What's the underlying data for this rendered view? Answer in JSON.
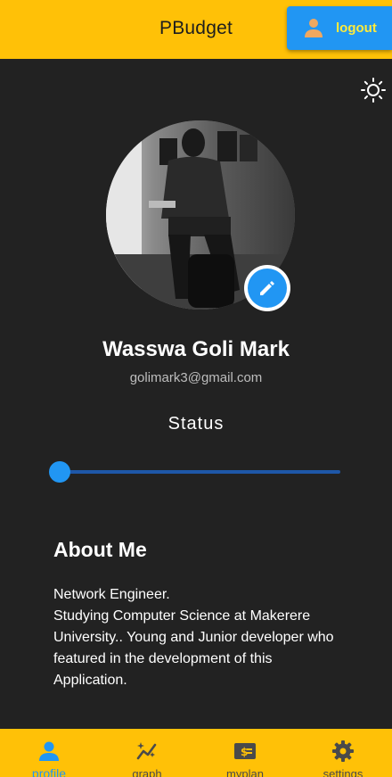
{
  "app_bar": {
    "title": "PBudget",
    "logout_label": "logout",
    "logout_icon": "person-icon"
  },
  "theme_toggle": {
    "icon": "sun-icon"
  },
  "profile": {
    "name": "Wasswa Goli Mark",
    "email": "golimark3@gmail.com",
    "edit_icon": "pencil-icon"
  },
  "status": {
    "label": "Status",
    "value": 0
  },
  "about": {
    "title": "About Me",
    "text": "Network Engineer.\nStudying Computer Science at Makerere University.. Young and Junior developer who featured in the development of this Application."
  },
  "bottom_nav": {
    "items": [
      {
        "label": "profile",
        "icon": "person-icon",
        "active": true
      },
      {
        "label": "graph",
        "icon": "auto-graph-icon",
        "active": false
      },
      {
        "label": "myplan",
        "icon": "money-plan-icon",
        "active": false
      },
      {
        "label": "settings",
        "icon": "gear-icon",
        "active": false
      }
    ]
  },
  "colors": {
    "accent": "#ffc107",
    "primary": "#2196f3",
    "background": "#222222"
  }
}
